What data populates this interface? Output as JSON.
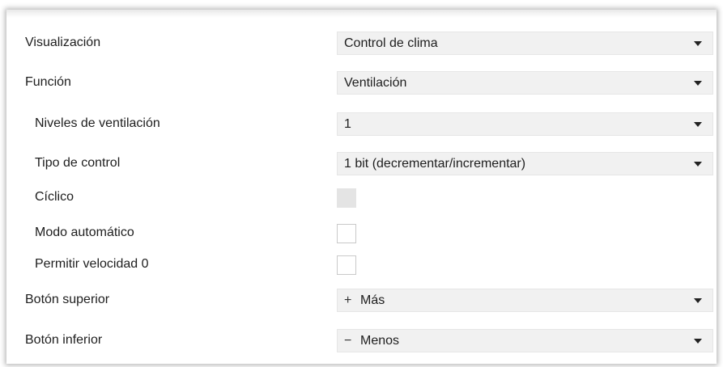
{
  "rows": [
    {
      "label": "Visualización",
      "type": "dropdown",
      "value": "Control de clima"
    },
    {
      "label": "Función",
      "type": "dropdown",
      "value": "Ventilación"
    },
    {
      "label": "Niveles de ventilación",
      "type": "dropdown",
      "value": "1"
    },
    {
      "label": "Tipo de control",
      "type": "dropdown",
      "value": "1 bit (decrementar/incrementar)"
    },
    {
      "label": "Cíclico",
      "type": "checkbox",
      "checked": false,
      "enabled": false
    },
    {
      "label": "Modo automático",
      "type": "checkbox",
      "checked": false,
      "enabled": true
    },
    {
      "label": "Permitir velocidad 0",
      "type": "checkbox",
      "checked": false,
      "enabled": true
    },
    {
      "label": "Botón superior",
      "type": "dropdown",
      "prefix": "+",
      "value": "Más"
    },
    {
      "label": "Botón inferior",
      "type": "dropdown",
      "prefix": "−",
      "value": "Menos"
    }
  ]
}
